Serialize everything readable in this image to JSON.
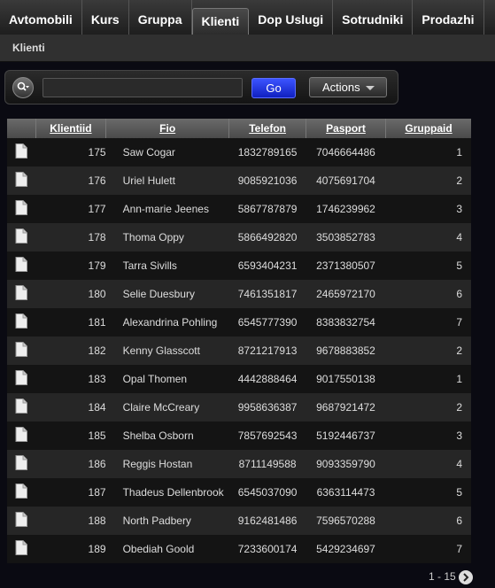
{
  "tabs": [
    "Avtomobili",
    "Kurs",
    "Gruppa",
    "Klienti",
    "Dop Uslugi",
    "Sotrudniki",
    "Prodazhi"
  ],
  "active_tab": "Klienti",
  "breadcrumb": "Klienti",
  "search": {
    "value": "",
    "go_label": "Go",
    "actions_label": "Actions"
  },
  "table": {
    "columns": [
      "Klientiid",
      "Fio",
      "Telefon",
      "Pasport",
      "Gruppaid"
    ],
    "rows": [
      [
        "175",
        "Saw Cogar",
        "1832789165",
        "7046664486",
        "1"
      ],
      [
        "176",
        "Uriel Hulett",
        "9085921036",
        "4075691704",
        "2"
      ],
      [
        "177",
        "Ann-marie Jeenes",
        "5867787879",
        "1746239962",
        "3"
      ],
      [
        "178",
        "Thoma Oppy",
        "5866492820",
        "3503852783",
        "4"
      ],
      [
        "179",
        "Tarra Sivills",
        "6593404231",
        "2371380507",
        "5"
      ],
      [
        "180",
        "Selie Duesbury",
        "7461351817",
        "2465972170",
        "6"
      ],
      [
        "181",
        "Alexandrina Pohling",
        "6545777390",
        "8383832754",
        "7"
      ],
      [
        "182",
        "Kenny Glasscott",
        "8721217913",
        "9678883852",
        "2"
      ],
      [
        "183",
        "Opal Thomen",
        "4442888464",
        "9017550138",
        "1"
      ],
      [
        "184",
        "Claire McCreary",
        "9958636387",
        "9687921472",
        "2"
      ],
      [
        "185",
        "Shelba Osborn",
        "7857692543",
        "5192446737",
        "3"
      ],
      [
        "186",
        "Reggis Hostan",
        "8711149588",
        "9093359790",
        "4"
      ],
      [
        "187",
        "Thadeus Dellenbrook",
        "6545037090",
        "6363114473",
        "5"
      ],
      [
        "188",
        "North Padbery",
        "9162481486",
        "7596570288",
        "6"
      ],
      [
        "189",
        "Obediah Goold",
        "7233600174",
        "5429234697",
        "7"
      ]
    ]
  },
  "pagination": {
    "label": "1 - 15"
  }
}
